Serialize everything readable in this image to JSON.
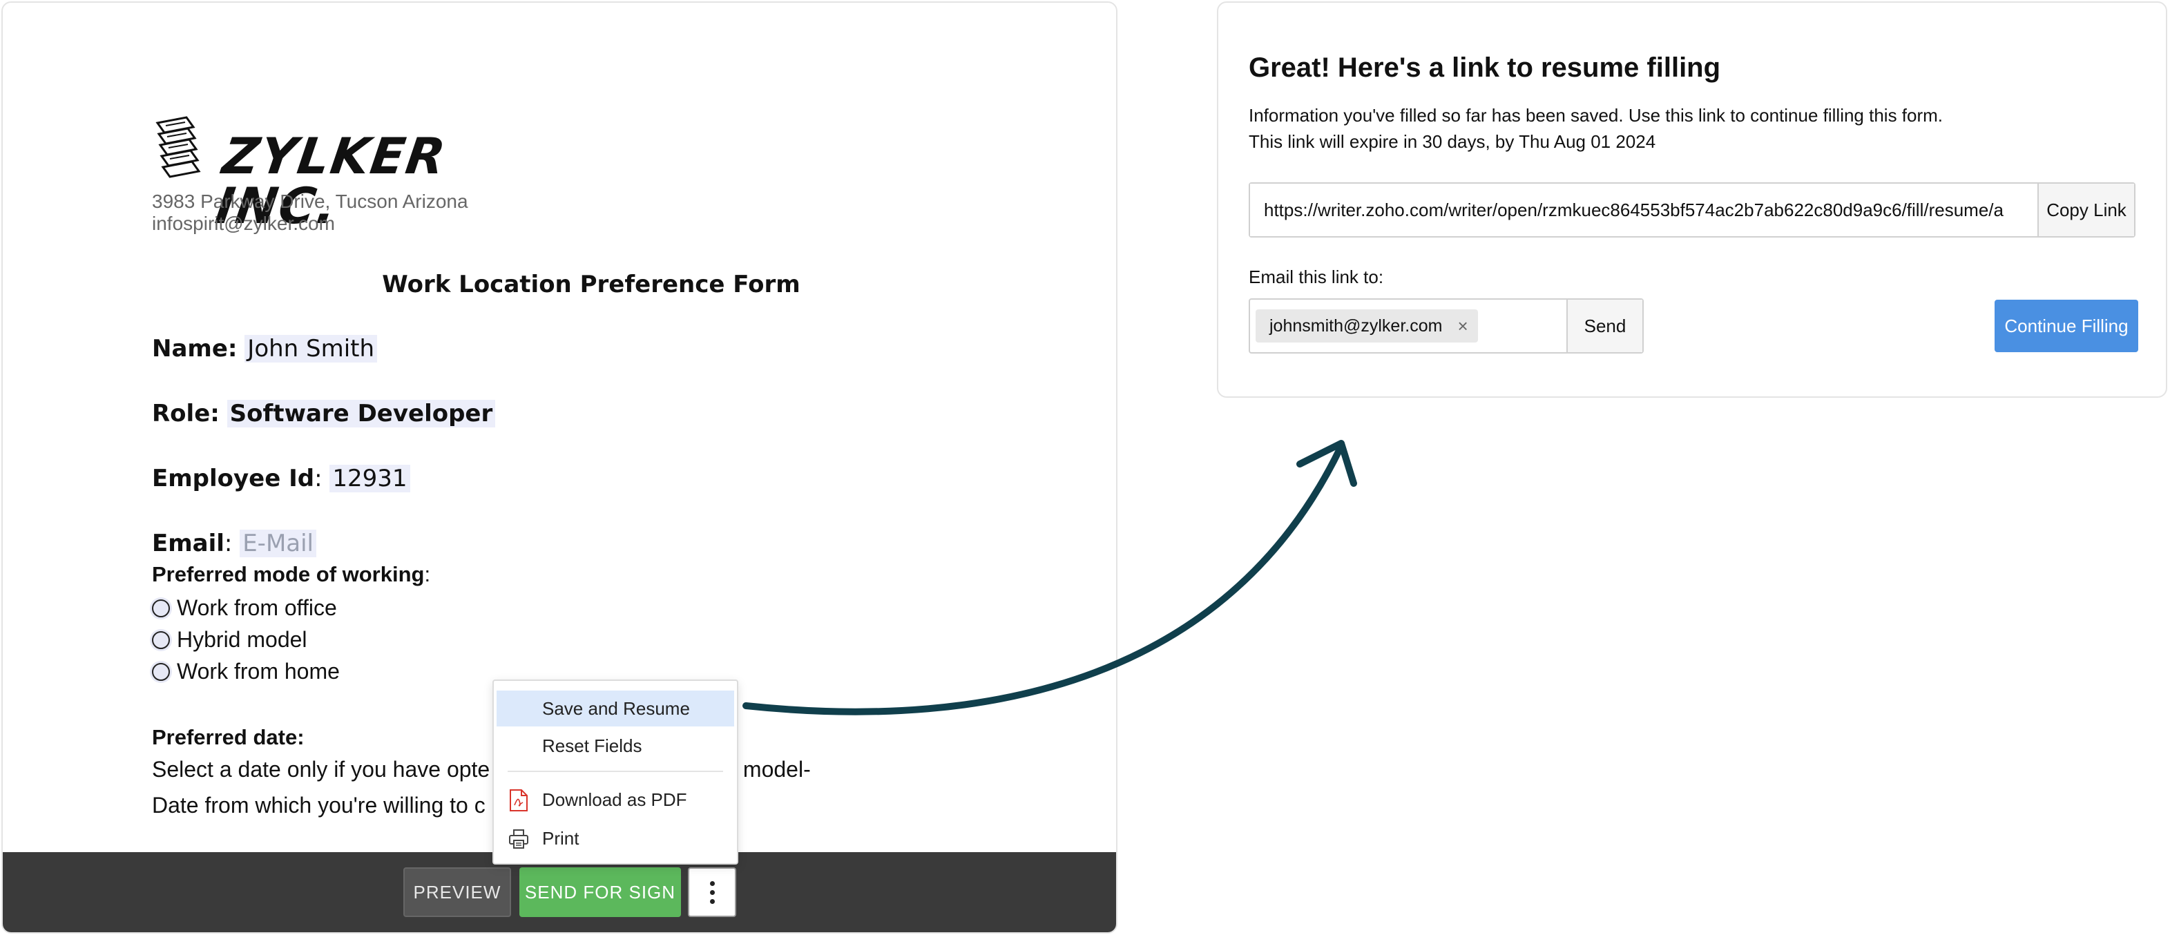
{
  "document": {
    "company_name": "ZYLKER INC.",
    "address": "3983 Parkway Drive, Tucson Arizona",
    "email": "infospirit@zylker.com",
    "form_title": "Work Location Preference Form",
    "fields": {
      "name_label": "Name:",
      "name_value": "John Smith",
      "role_label": "Role:",
      "role_value": "Software Developer",
      "empid_label": "Employee Id",
      "empid_value": "12931",
      "email_label": "Email",
      "email_placeholder": "E-Mail",
      "colon": ":"
    },
    "preferred_mode_label": "Preferred mode of working",
    "modes": [
      "Work from office",
      "Hybrid model",
      "Work from home"
    ],
    "preferred_date_label": "Preferred date:",
    "para_1": "Select a date only if you have opte",
    "para_1_tail": "d model-",
    "para_2": "Date from which you're willing to c"
  },
  "context_menu": {
    "items": [
      {
        "label": "Save and Resume",
        "icon": "",
        "active": true
      },
      {
        "label": "Reset Fields",
        "icon": "",
        "active": false
      },
      {
        "label": "Download as PDF",
        "icon": "pdf-icon",
        "active": false
      },
      {
        "label": "Print",
        "icon": "printer-icon",
        "active": false
      }
    ]
  },
  "toolbar": {
    "preview_label": "PREVIEW",
    "send_for_sign_label": "SEND FOR SIGN",
    "more_icon": "kebab-menu-icon",
    "send_color": "#5cb85c"
  },
  "resume_card": {
    "title": "Great! Here's a link to resume filling",
    "info_line_1": "Information you've filled so far has been saved. Use this link to continue filling this form.",
    "info_line_2": "This link will expire in 30 days, by Thu Aug 01 2024",
    "link_url": "https://writer.zoho.com/writer/open/rzmkuec864553bf574ac2b7ab622c80d9a9c6/fill/resume/a",
    "copy_link_label": "Copy Link",
    "email_label": "Email this link to:",
    "email_chip": "johnsmith@zylker.com",
    "send_label": "Send",
    "continue_label": "Continue Filling",
    "accent_color": "#4a90e2"
  }
}
